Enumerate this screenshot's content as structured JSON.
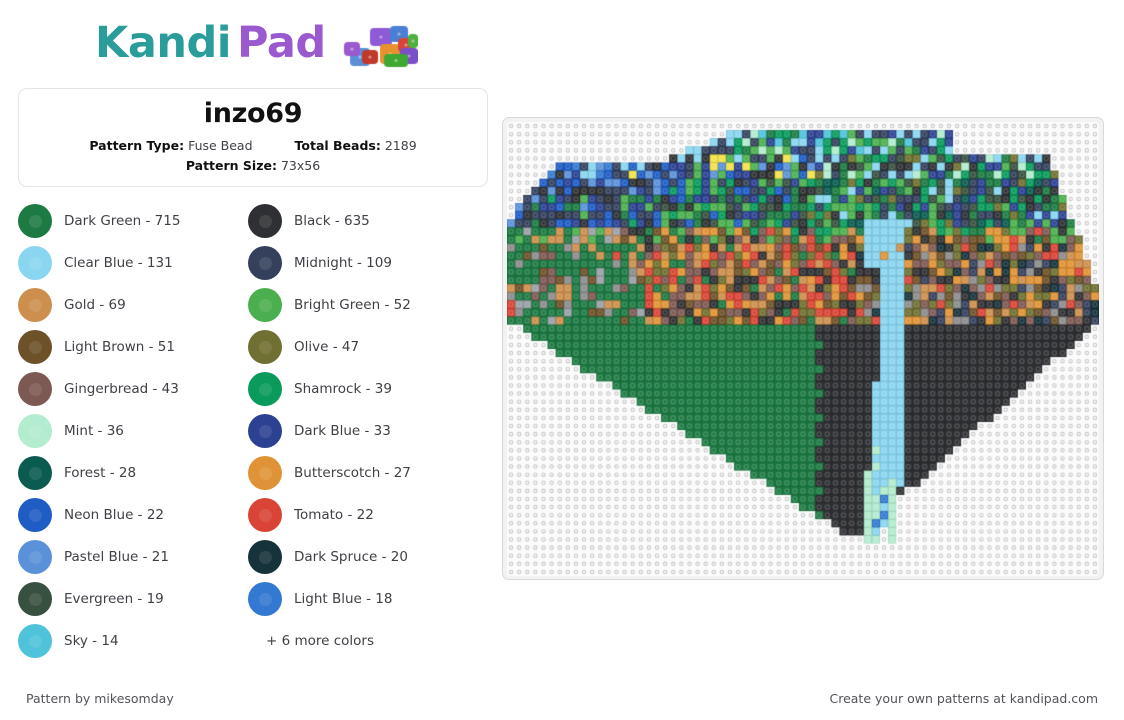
{
  "brand": {
    "name_part1": "Kandi",
    "name_part2": "Pad",
    "color_teal": "#2a9d9b",
    "color_purple": "#9b59d0",
    "logo_icon": "bead-cluster-icon",
    "logo_bead_colors": [
      "#8e5ad6",
      "#4a7fd4",
      "#e8922f",
      "#d9443a",
      "#3fa832",
      "#5a8fd8",
      "#9b59d0",
      "#e8922f",
      "#4fb03f",
      "#7b4fc9"
    ]
  },
  "info_card": {
    "title": "inzo69",
    "pattern_type_label": "Pattern Type:",
    "pattern_type_value": "Fuse Bead",
    "total_beads_label": "Total Beads:",
    "total_beads_value": "2189",
    "pattern_size_label": "Pattern Size:",
    "pattern_size_value": "73x56"
  },
  "legend": {
    "more_colors_label": "+ 6 more colors",
    "items": [
      {
        "name": "Dark Green",
        "count": 715,
        "label": "Dark Green - 715",
        "color": "#1d7a43"
      },
      {
        "name": "Black",
        "count": 635,
        "label": "Black - 635",
        "color": "#2e3033"
      },
      {
        "name": "Clear Blue",
        "count": 131,
        "label": "Clear Blue - 131",
        "color": "#8ad6f0"
      },
      {
        "name": "Midnight",
        "count": 109,
        "label": "Midnight - 109",
        "color": "#34405c"
      },
      {
        "name": "Gold",
        "count": 69,
        "label": "Gold - 69",
        "color": "#cc8f4e"
      },
      {
        "name": "Bright Green",
        "count": 52,
        "label": "Bright Green - 52",
        "color": "#4caf4f"
      },
      {
        "name": "Light Brown",
        "count": 51,
        "label": "Light Brown - 51",
        "color": "#6d5129"
      },
      {
        "name": "Olive",
        "count": 47,
        "label": "Olive - 47",
        "color": "#6f7031"
      },
      {
        "name": "Gingerbread",
        "count": 43,
        "label": "Gingerbread - 43",
        "color": "#7d5953"
      },
      {
        "name": "Shamrock",
        "count": 39,
        "label": "Shamrock - 39",
        "color": "#099a5c"
      },
      {
        "name": "Mint",
        "count": 36,
        "label": "Mint - 36",
        "color": "#b3ecce"
      },
      {
        "name": "Dark Blue",
        "count": 33,
        "label": "Dark Blue - 33",
        "color": "#2c4191"
      },
      {
        "name": "Forest",
        "count": 28,
        "label": "Forest - 28",
        "color": "#0b5b51"
      },
      {
        "name": "Butterscotch",
        "count": 27,
        "label": "Butterscotch - 27",
        "color": "#e09336"
      },
      {
        "name": "Neon Blue",
        "count": 22,
        "label": "Neon Blue - 22",
        "color": "#1f5cc4"
      },
      {
        "name": "Tomato",
        "count": 22,
        "label": "Tomato - 22",
        "color": "#d94436"
      },
      {
        "name": "Pastel Blue",
        "count": 21,
        "label": "Pastel Blue - 21",
        "color": "#5b91d9"
      },
      {
        "name": "Dark Spruce",
        "count": 20,
        "label": "Dark Spruce - 20",
        "color": "#16323a"
      },
      {
        "name": "Evergreen",
        "count": 19,
        "label": "Evergreen - 19",
        "color": "#38503f"
      },
      {
        "name": "Light Blue",
        "count": 18,
        "label": "Light Blue - 18",
        "color": "#3479d1"
      },
      {
        "name": "Sky",
        "count": 14,
        "label": "Sky - 14",
        "color": "#4fc3da"
      }
    ]
  },
  "pattern": {
    "name": "inzo69",
    "cols": 73,
    "rows": 56,
    "empty_peg_color": "#fbfbfb",
    "empty_peg_ring": "#c9c9c9",
    "board_color": "#f2f2f2",
    "palette": {
      ".": null,
      "G": "#1d7a43",
      "K": "#2e3033",
      "C": "#8ad6f0",
      "M": "#34405c",
      "o": "#cc8f4e",
      "b": "#4caf4f",
      "L": "#6d5129",
      "v": "#6f7031",
      "n": "#7d5953",
      "s": "#099a5c",
      "t": "#b3ecce",
      "D": "#2c4191",
      "F": "#0b5b51",
      "u": "#e09336",
      "N": "#1f5cc4",
      "r": "#d94436",
      "P": "#5b91d9",
      "S": "#16323a",
      "E": "#38503f",
      "l": "#3479d1",
      "y": "#4fc3da",
      "w": "#9aa0a6",
      "Y": "#f2e34a",
      "g": "#8c8c8c"
    }
  },
  "footer": {
    "credit": "Pattern by mikesomday",
    "promo": "Create your own patterns at kandipad.com"
  }
}
